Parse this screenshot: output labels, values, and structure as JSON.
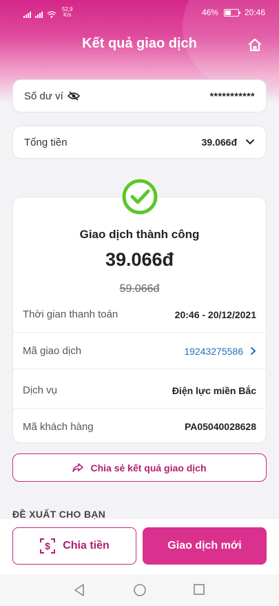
{
  "status_bar": {
    "net_speed_value": "52,9",
    "net_speed_unit": "K/s",
    "battery": "46%",
    "time": "20:46",
    "battery_level": 0.46
  },
  "header": {
    "title": "Kết quả giao dịch",
    "home_icon": "home-icon"
  },
  "wallet": {
    "label": "Số dư ví",
    "masked_balance": "***********",
    "visibility_icon": "eye-off-icon"
  },
  "total": {
    "label": "Tổng tiền",
    "amount": "39.066đ",
    "expand_icon": "chevron-down-icon"
  },
  "result": {
    "status_icon": "check-circle-icon",
    "status_text": "Giao dịch thành công",
    "amount": "39.066đ",
    "original_amount": "59.066đ",
    "details": [
      {
        "label": "Thời gian thanh toán",
        "value": "20:46 - 20/12/2021"
      },
      {
        "label": "Mã giao dịch",
        "value": "19243275586"
      },
      {
        "label": "Dịch vụ",
        "value": "Điện lực miền Bắc"
      },
      {
        "label": "Mã khách hàng",
        "value": "PA05040028628"
      }
    ]
  },
  "share": {
    "label": "Chia sẻ kết quả giao dịch",
    "icon": "share-icon"
  },
  "suggest": {
    "title": "ĐỀ XUẤT CHO BẠN"
  },
  "actions": {
    "split_label": "Chia tiền",
    "split_icon": "split-money-icon",
    "new_label": "Giao dịch mới"
  },
  "colors": {
    "brand": "#d9318d",
    "brand_dark": "#b01e72",
    "link": "#1e6fb8",
    "success": "#5cc62a"
  }
}
